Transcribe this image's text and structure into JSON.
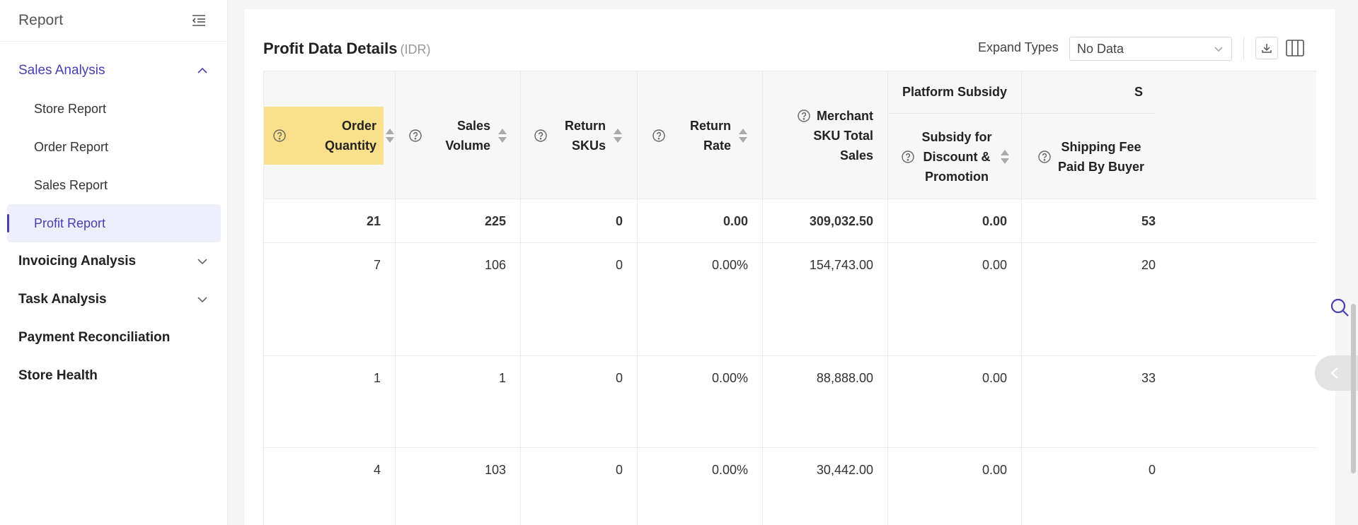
{
  "sidebar": {
    "title": "Report",
    "groups": [
      {
        "label": "Sales Analysis",
        "expanded": true
      },
      {
        "label": "Invoicing Analysis",
        "expanded": false
      },
      {
        "label": "Task Analysis",
        "expanded": false
      },
      {
        "label": "Payment Reconciliation"
      },
      {
        "label": "Store Health"
      }
    ],
    "items": [
      {
        "label": "Store Report"
      },
      {
        "label": "Order Report"
      },
      {
        "label": "Sales Report"
      },
      {
        "label": "Profit Report",
        "active": true
      }
    ]
  },
  "main": {
    "title": "Profit Data Details",
    "unit": "(IDR)",
    "expand_label": "Expand Types",
    "expand_value": "No Data"
  },
  "table": {
    "group_headers": [
      "Platform Subsidy",
      "S"
    ],
    "headers": [
      "Order Quantity",
      "Sales Volume",
      "Return SKUs",
      "Return Rate",
      "Merchant SKU Total Sales",
      "Subsidy for Discount & Promotion",
      "Shipping Fee Paid By Buyer"
    ],
    "rows": [
      [
        "21",
        "225",
        "0",
        "0.00",
        "309,032.50",
        "0.00",
        "53"
      ],
      [
        "7",
        "106",
        "0",
        "0.00%",
        "154,743.00",
        "0.00",
        "20"
      ],
      [
        "1",
        "1",
        "0",
        "0.00%",
        "88,888.00",
        "0.00",
        "33"
      ],
      [
        "4",
        "103",
        "0",
        "0.00%",
        "30,442.00",
        "0.00",
        "0"
      ]
    ]
  },
  "colors": {
    "accent": "#4a3db5",
    "highlight": "#fae08a"
  }
}
